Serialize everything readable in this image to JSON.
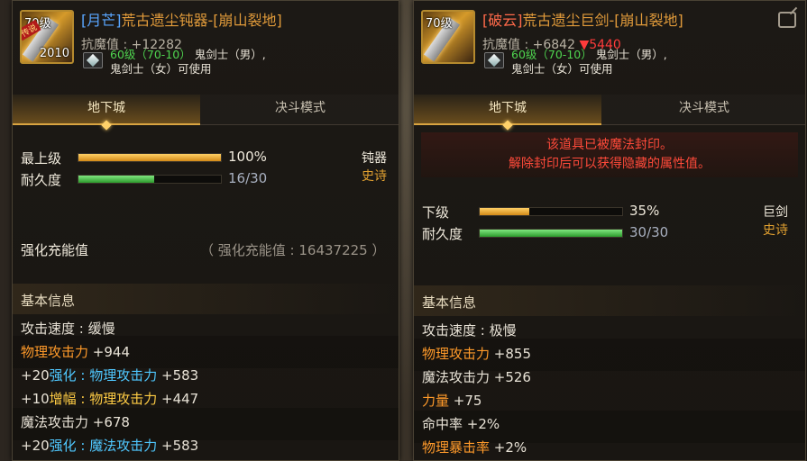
{
  "left": {
    "icon": {
      "level": "70级",
      "count": "2010",
      "tag": "传说"
    },
    "name": {
      "prefix": "[月芒]",
      "main": "荒古遗尘钝器-[崩山裂地]"
    },
    "resist": {
      "label": "抗魔值 : +12282"
    },
    "requirement": {
      "level": "60级（70-10）",
      "class_line1": " 鬼剑士（男）,",
      "class_line2": "鬼剑士（女）可使用"
    },
    "tabs": [
      {
        "label": "地下城",
        "active": true
      },
      {
        "label": "决斗模式",
        "active": false
      }
    ],
    "stats": [
      {
        "label": "最上级",
        "value": "100%",
        "fill": 1.0,
        "color": "orange"
      },
      {
        "label": "耐久度",
        "value": "16/30",
        "fill": 0.533,
        "color": "green"
      }
    ],
    "type": "钝器",
    "rarity": "史诗",
    "charge": {
      "label": "强化充能值",
      "value": "（ 强化充能值 : 16437225 ）"
    },
    "section": "基本信息",
    "attrs": [
      {
        "a": "攻击速度 : 缓慢",
        "b": "",
        "c": ""
      },
      {
        "a": "物理攻击力",
        "b": " +944",
        "c": ""
      },
      {
        "a": "+20",
        "b": "强化 : 物理攻击力",
        "c": " +583"
      },
      {
        "a": " +10",
        "b": "增幅 : 物理攻击力",
        "c": " +447"
      },
      {
        "a": "魔法攻击力 +678",
        "b": "",
        "c": ""
      },
      {
        "a": "+20",
        "b": "强化 : 魔法攻击力",
        "c": " +583"
      }
    ]
  },
  "right": {
    "icon": {
      "level": "70级"
    },
    "name": {
      "prefix": "[破云]",
      "main": "荒古遗尘巨剑-[崩山裂地]"
    },
    "resist": {
      "label": "抗魔值 : +6842",
      "drop": "▼5440"
    },
    "requirement": {
      "level": "60级（70-10）",
      "class_line1": " 鬼剑士（男）,",
      "class_line2": "鬼剑士（女）可使用"
    },
    "tabs": [
      {
        "label": "地下城",
        "active": true
      },
      {
        "label": "决斗模式",
        "active": false
      }
    ],
    "seal": {
      "line1": "该道具已被魔法封印。",
      "line2": "解除封印后可以获得隐藏的属性值。"
    },
    "stats": [
      {
        "label": "下级",
        "value": "35%",
        "fill": 0.35,
        "color": "orange"
      },
      {
        "label": "耐久度",
        "value": "30/30",
        "fill": 1.0,
        "color": "green"
      }
    ],
    "type": "巨剑",
    "rarity": "史诗",
    "section": "基本信息",
    "attrs": [
      {
        "a": "攻击速度 : 极慢",
        "b": ""
      },
      {
        "a": "物理攻击力",
        "b": " +855"
      },
      {
        "a": "魔法攻击力 +526",
        "b": ""
      },
      {
        "a": "力量",
        "b": " +75"
      },
      {
        "a": "命中率 +2%",
        "b": ""
      },
      {
        "a": "物理暴击率",
        "b": " +2%"
      }
    ]
  },
  "colors": {
    "orange_bar": "#d38a17",
    "green_bar": "#2d9a2d",
    "epic": "#e0a030",
    "seal_red": "#ff4a3a"
  }
}
